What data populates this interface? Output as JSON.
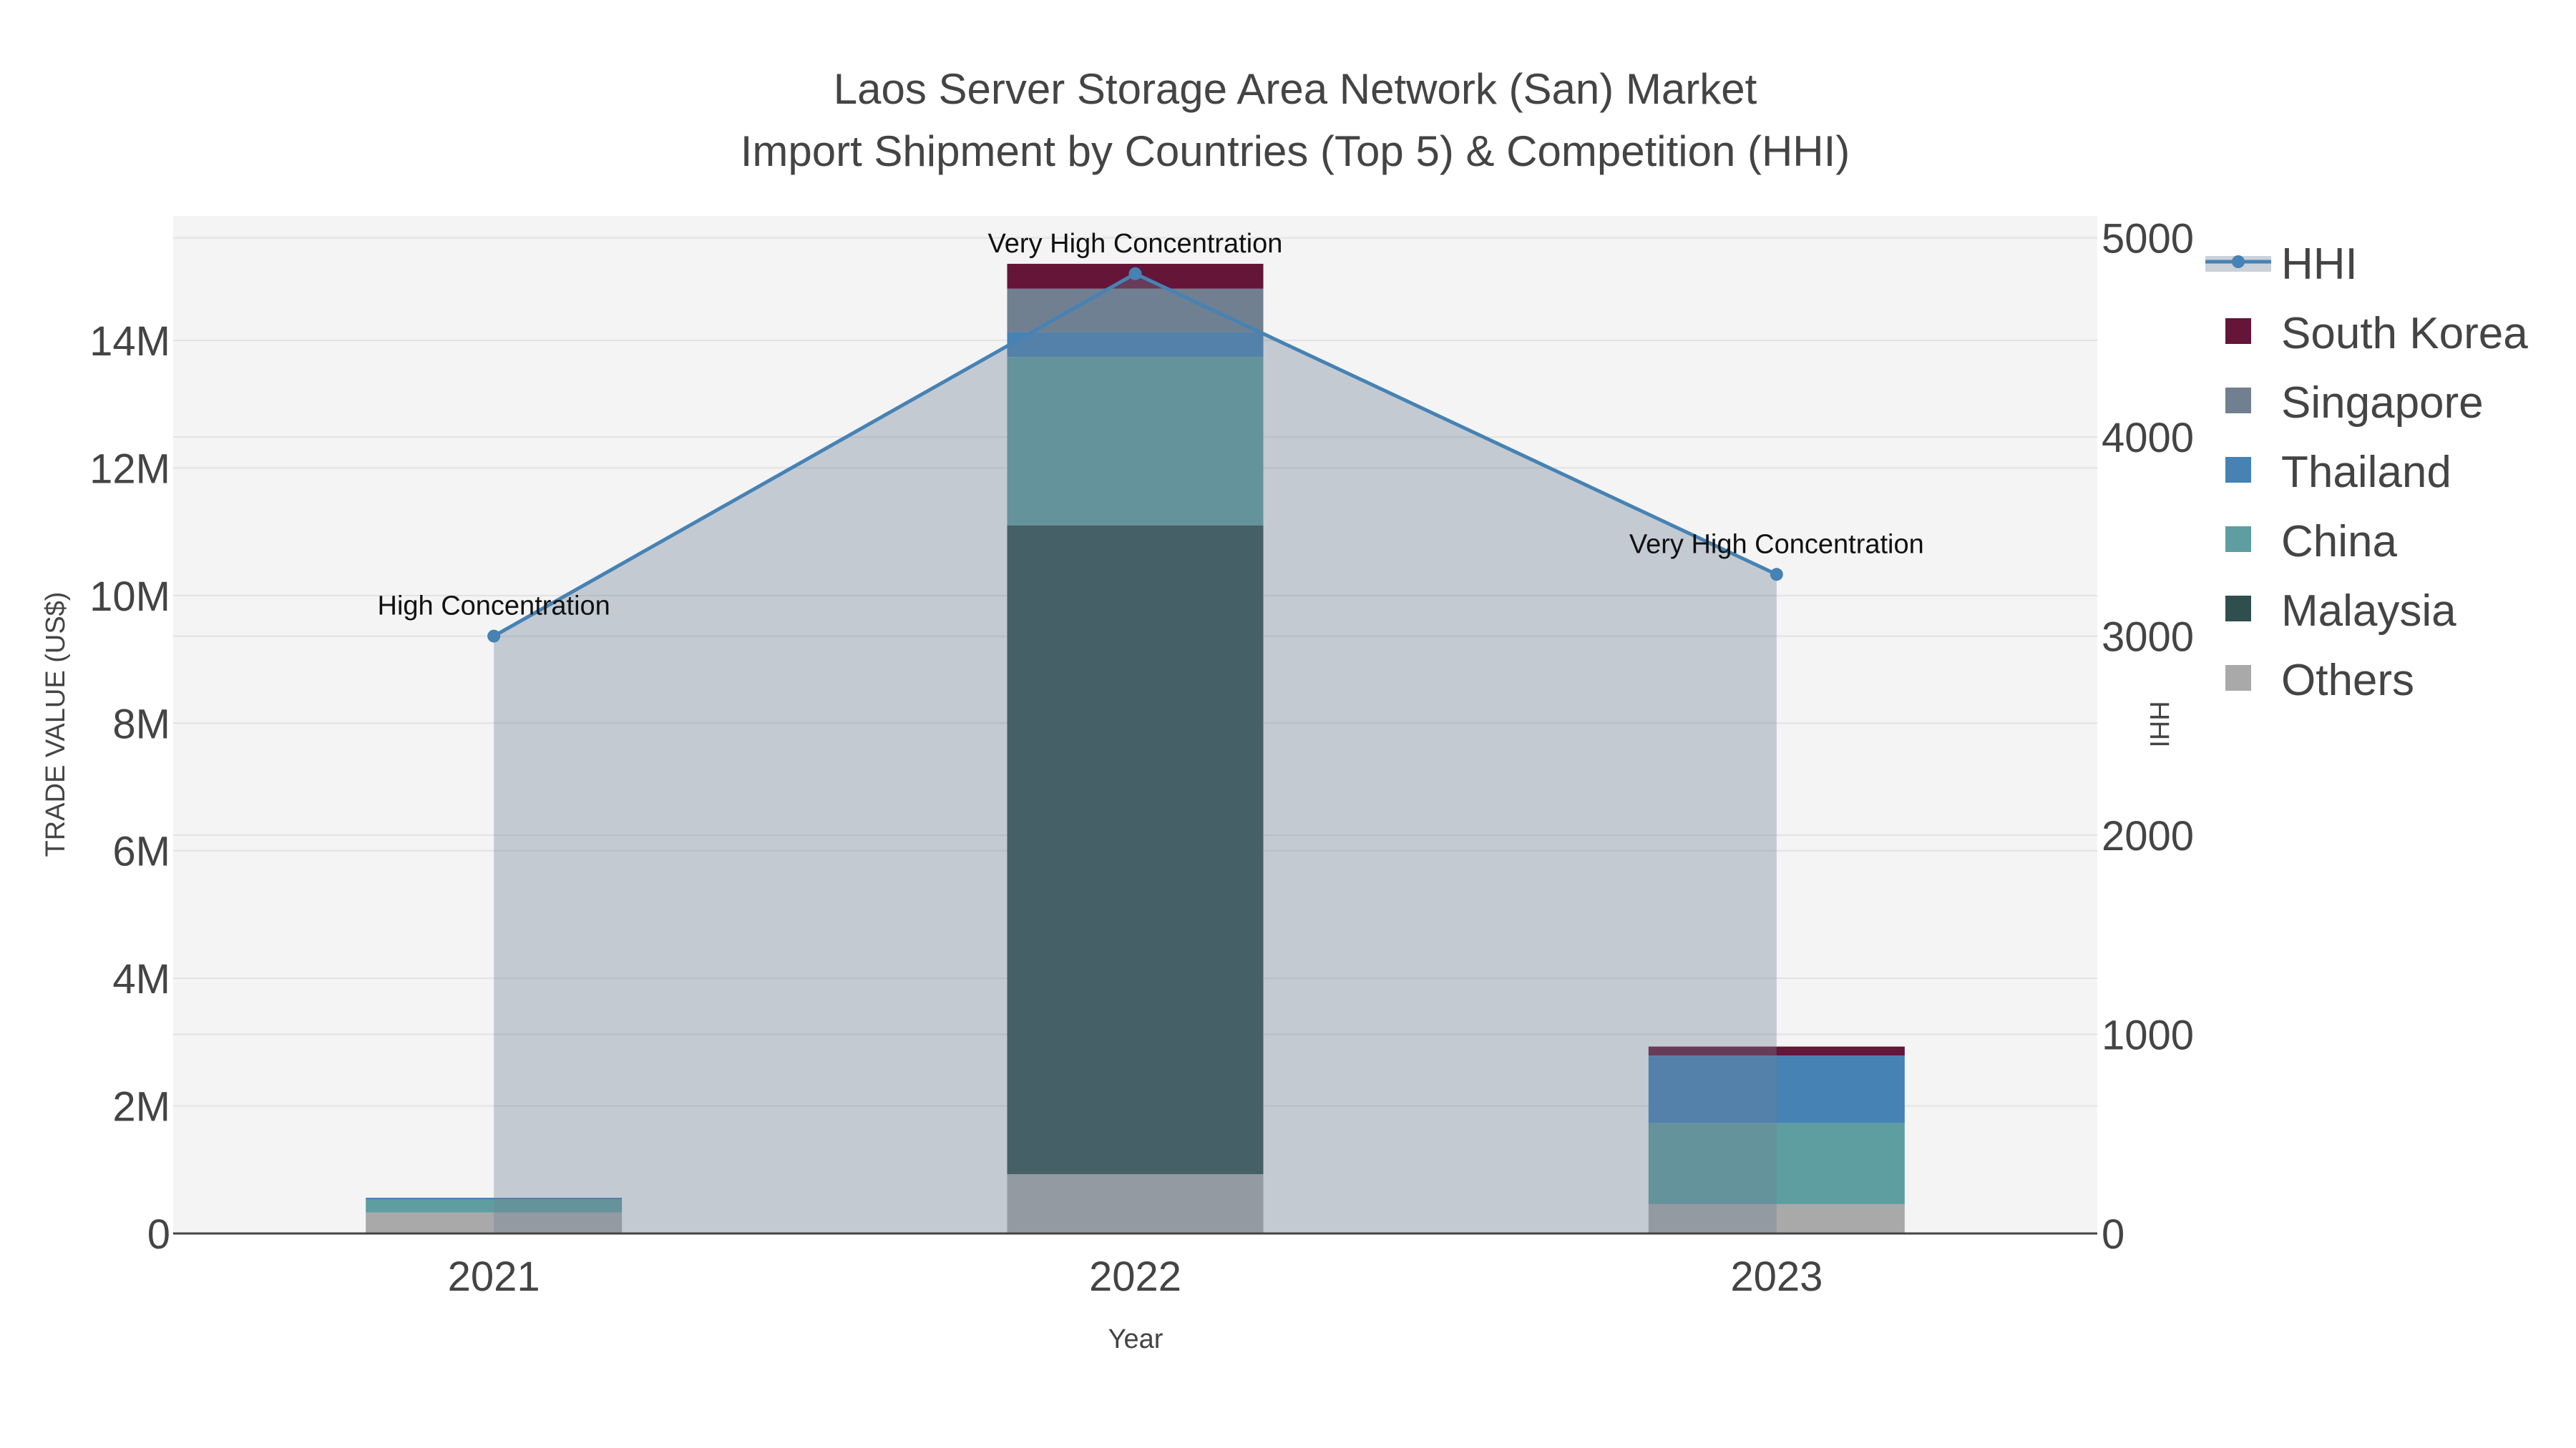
{
  "chart_data": {
    "type": "bar",
    "title": [
      "Laos Server Storage Area Network (San) Market",
      "Import Shipment by Countries (Top 5) & Competition (HHI)"
    ],
    "xlabel": "Year",
    "ylabel": "TRADE VALUE (US$)",
    "y2label": "HHI",
    "categories": [
      "2021",
      "2022",
      "2023"
    ],
    "ylim": [
      0,
      15950000
    ],
    "y2lim": [
      0,
      5110
    ],
    "yticks": [
      0,
      2000000,
      4000000,
      6000000,
      8000000,
      10000000,
      12000000,
      14000000
    ],
    "ytick_labels": [
      "0",
      "2M",
      "4M",
      "6M",
      "8M",
      "10M",
      "12M",
      "14M"
    ],
    "y2ticks": [
      0,
      1000,
      2000,
      3000,
      4000,
      5000
    ],
    "y2tick_labels": [
      "0",
      "1000",
      "2000",
      "3000",
      "4000",
      "5000"
    ],
    "stacked": true,
    "series": [
      {
        "name": "Others",
        "color": "#a9a9a9",
        "values": [
          330000,
          930000,
          460000
        ]
      },
      {
        "name": "Malaysia",
        "color": "#2f4f4f",
        "values": [
          0,
          10170000,
          0
        ]
      },
      {
        "name": "China",
        "color": "#5f9ea0",
        "values": [
          200000,
          2640000,
          1270000
        ]
      },
      {
        "name": "Thailand",
        "color": "#4682b4",
        "values": [
          30000,
          390000,
          1060000
        ]
      },
      {
        "name": "Singapore",
        "color": "#708090",
        "values": [
          0,
          680000,
          0
        ]
      },
      {
        "name": "South Korea",
        "color": "#641538",
        "values": [
          0,
          390000,
          140000
        ]
      }
    ],
    "hhi": {
      "name": "HHI",
      "color": "#4682b4",
      "values": [
        3000,
        4820,
        3310
      ]
    },
    "annotations": [
      "High Concentration",
      "Very High Concentration",
      "Very High Concentration"
    ],
    "legend": [
      "HHI",
      "South Korea",
      "Singapore",
      "Thailand",
      "China",
      "Malaysia",
      "Others"
    ],
    "legend_placement": "top-right",
    "grid": true
  }
}
